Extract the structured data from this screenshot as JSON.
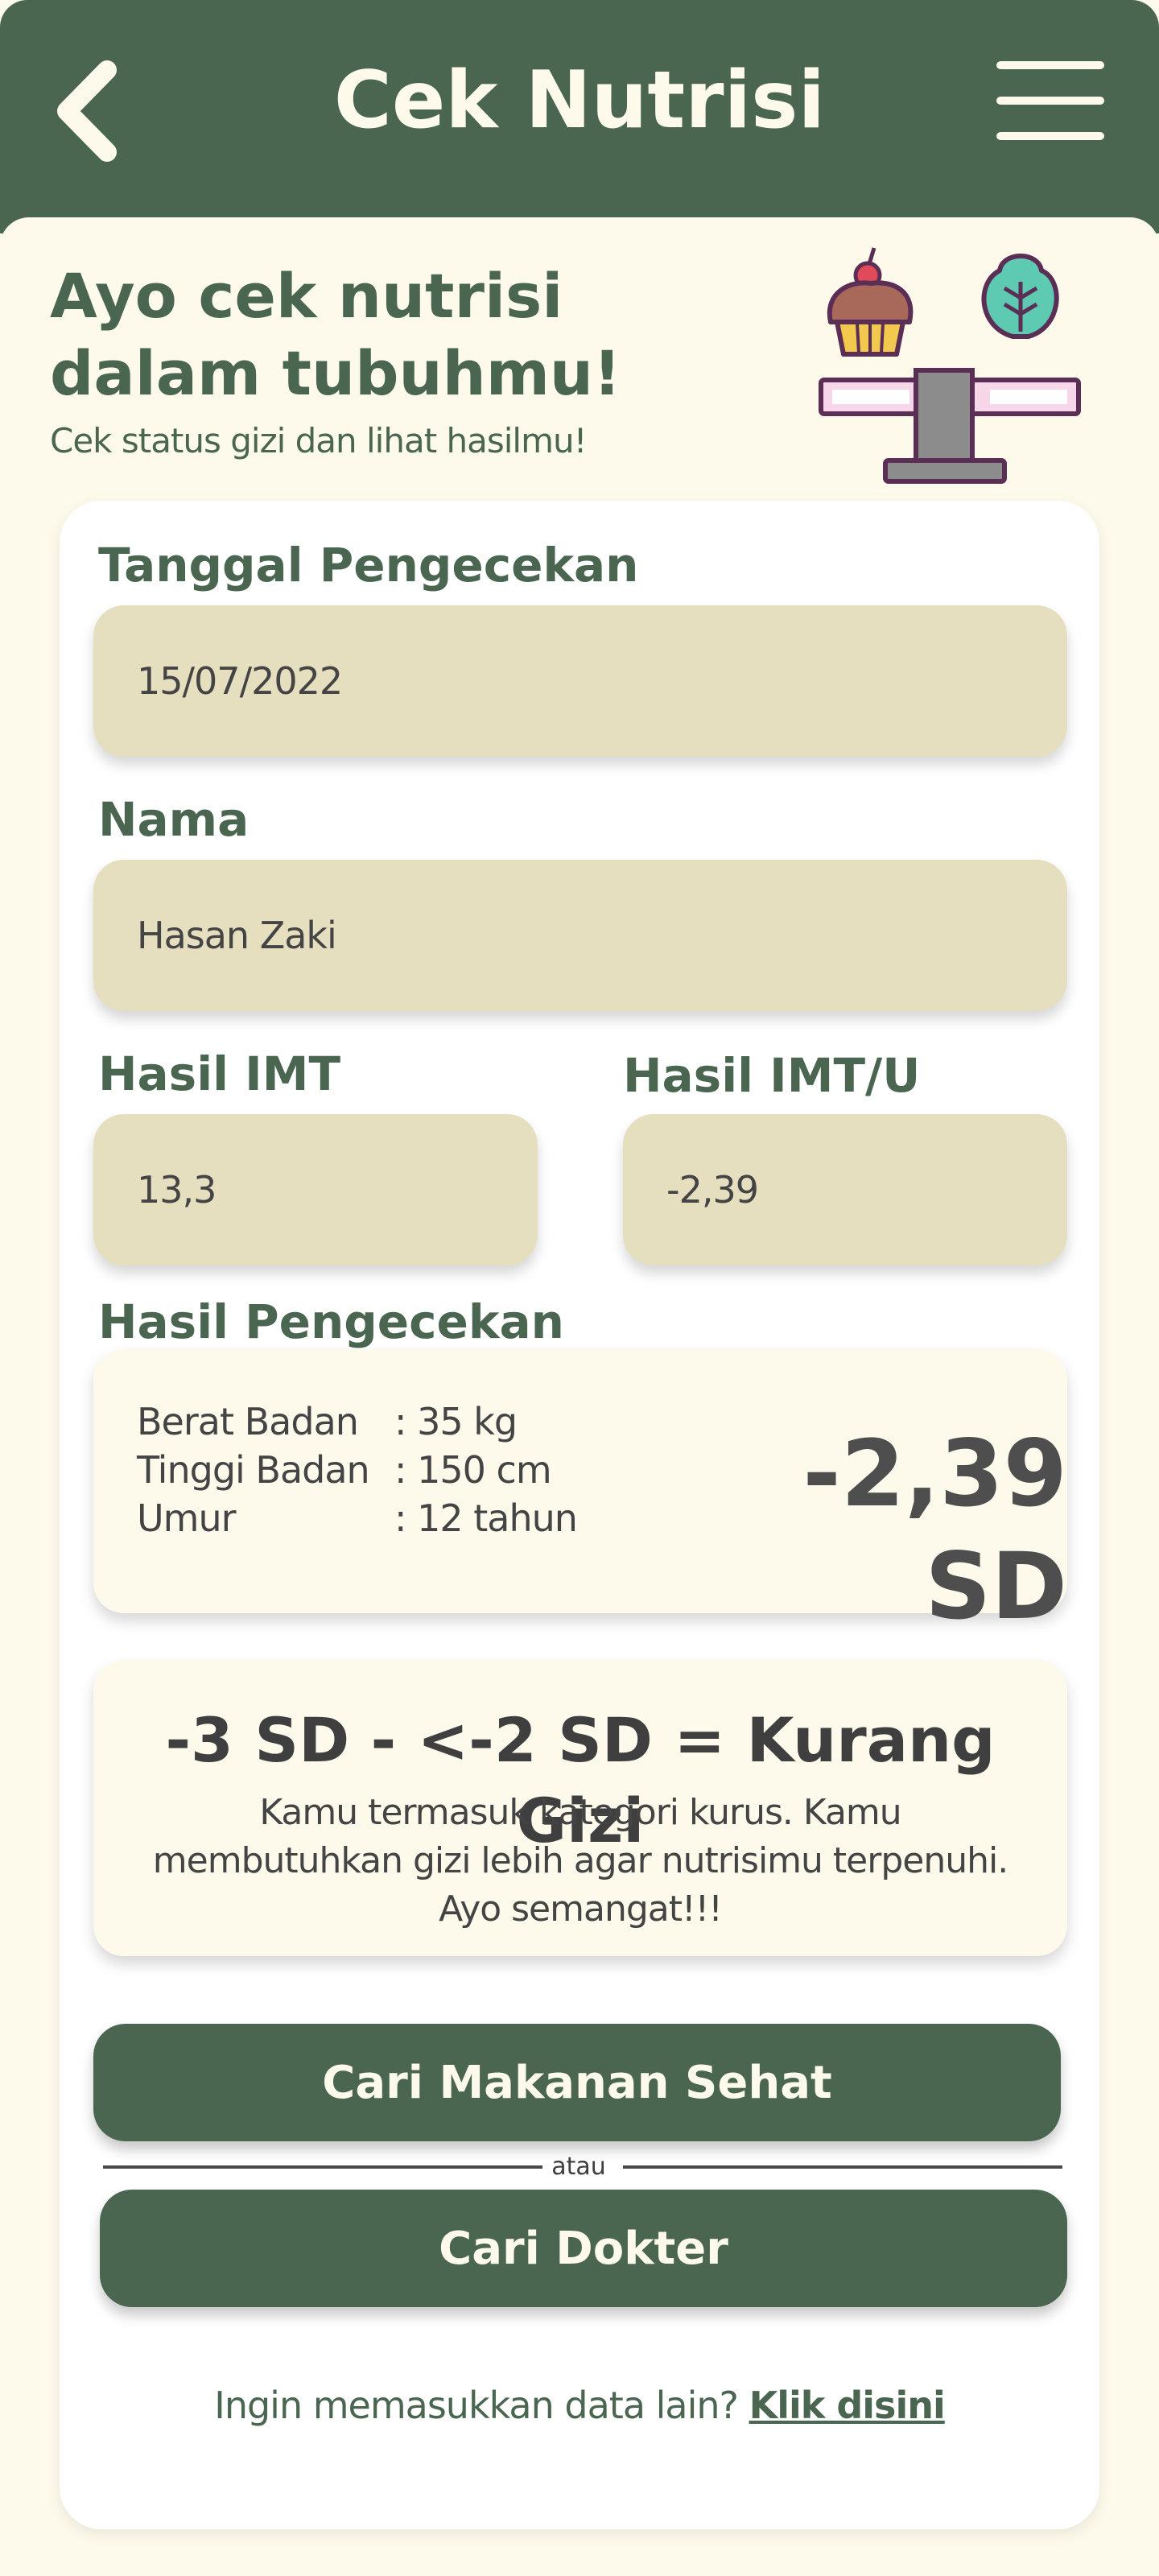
{
  "header": {
    "title": "Cek Nutrisi",
    "back_icon": "chevron-left-icon",
    "menu_icon": "hamburger-menu-icon"
  },
  "intro": {
    "title": "Ayo cek nutrisi dalam tubuhmu!",
    "subtitle": "Cek status gizi dan lihat hasilmu!",
    "illustration": "food-scale-illustration"
  },
  "form": {
    "date_label": "Tanggal Pengecekan",
    "date_value": "15/07/2022",
    "name_label": "Nama",
    "name_value": "Hasan Zaki",
    "imt_label": "Hasil IMT",
    "imt_value": "13,3",
    "imtu_label": "Hasil IMT/U",
    "imtu_value": "-2,39"
  },
  "result": {
    "label": "Hasil Pengecekan",
    "measurements": [
      {
        "key": "Berat Badan",
        "value": ": 35 kg"
      },
      {
        "key": "Tinggi Badan",
        "value": ": 150 cm"
      },
      {
        "key": "Umur",
        "value": ": 12 tahun"
      }
    ],
    "sd_value": "-2,39 SD"
  },
  "category": {
    "title": "-3 SD - <-2 SD = Kurang Gizi",
    "description": "Kamu termasuk kategori kurus. Kamu membutuhkan gizi lebih agar nutrisimu terpenuhi. Ayo semangat!!!"
  },
  "actions": {
    "food_button": "Cari Makanan Sehat",
    "divider": "atau",
    "doctor_button": "Cari Dokter"
  },
  "footer": {
    "question": "Ingin memasukkan data lain?",
    "link": "Klik disini"
  },
  "colors": {
    "primary": "#4A6651",
    "background": "#FDFAEC",
    "field": "#E5DFC0",
    "card": "#FFFFFF"
  }
}
